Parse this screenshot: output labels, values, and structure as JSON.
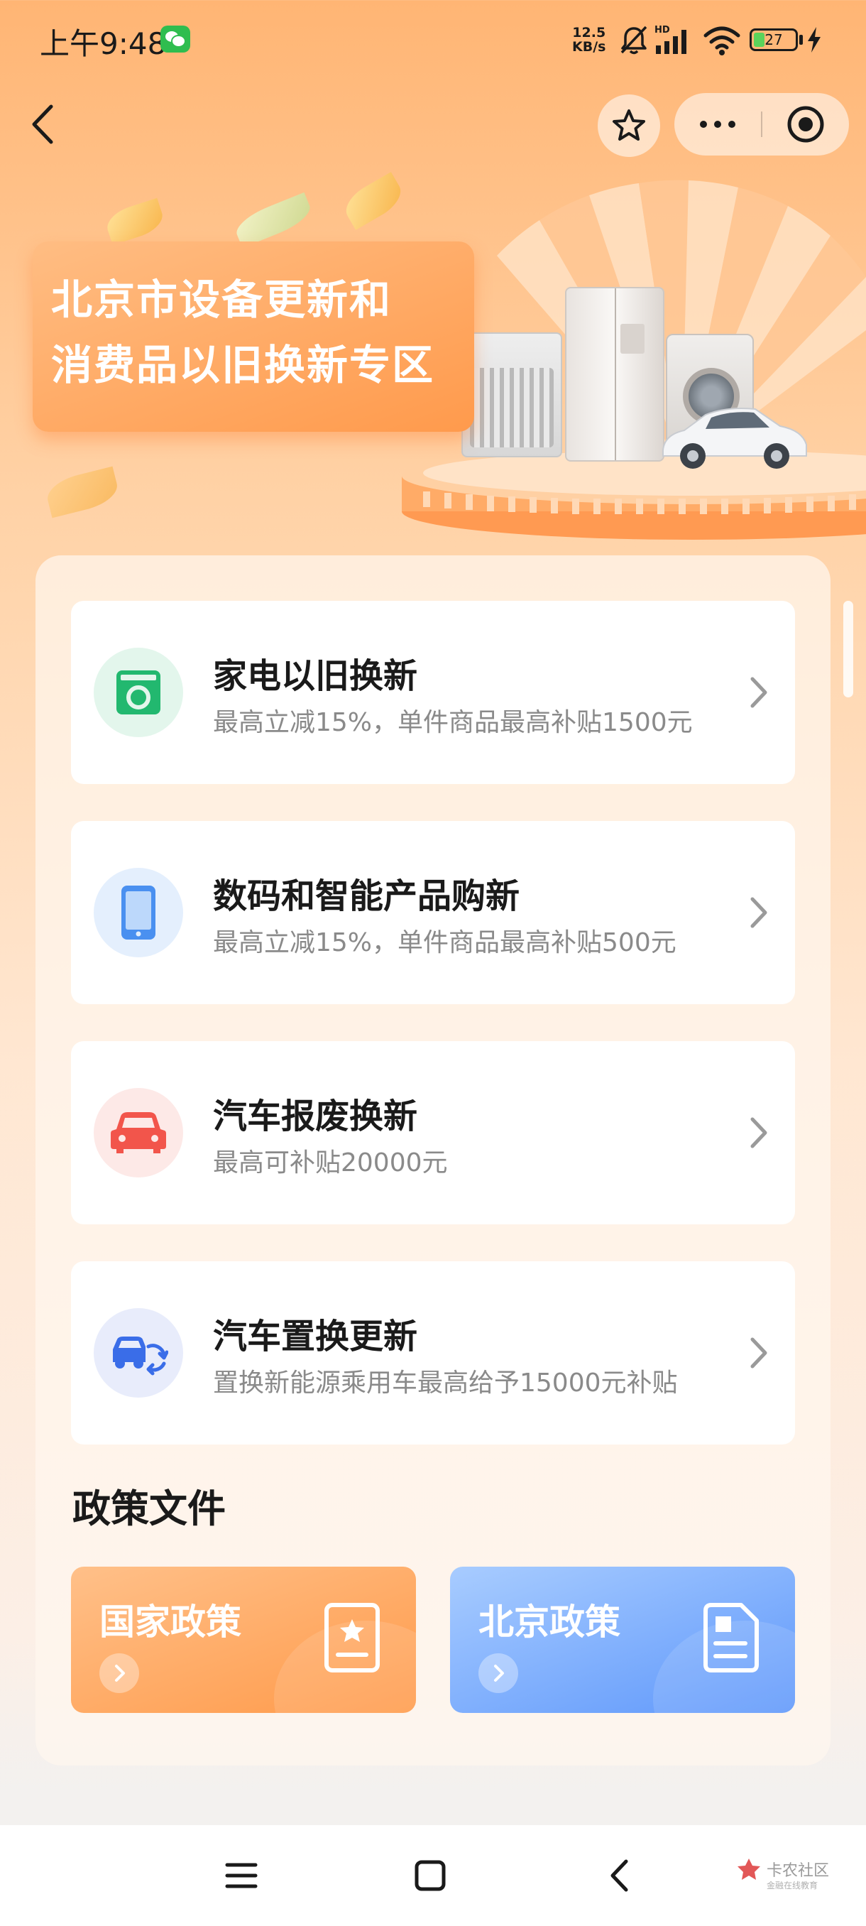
{
  "status_bar": {
    "time": "上午9:48",
    "net_speed_value": "12.5",
    "net_speed_unit": "KB/s",
    "network_type": "HD",
    "battery_level": "27",
    "icons": [
      "wechat-icon",
      "mute-bell-icon",
      "signal-icon",
      "wifi-icon",
      "battery-icon",
      "charging-icon"
    ]
  },
  "nav": {
    "icons": [
      "back-icon",
      "star-icon",
      "more-icon",
      "close-mini-program-icon"
    ]
  },
  "hero": {
    "title_line1": "北京市设备更新和",
    "title_line2": "消费品以旧换新专区"
  },
  "services": [
    {
      "title": "家电以旧换新",
      "subtitle": "最高立减15%，单件商品最高补贴1500元",
      "icon": "washing-machine-icon",
      "icon_color": "#22b86f",
      "icon_bg": "#e3f6ec"
    },
    {
      "title": "数码和智能产品购新",
      "subtitle": "最高立减15%，单件商品最高补贴500元",
      "icon": "phone-icon",
      "icon_color": "#4a90f0",
      "icon_bg": "#e4effd"
    },
    {
      "title": "汽车报废换新",
      "subtitle": "最高可补贴20000元",
      "icon": "car-icon",
      "icon_color": "#f2554b",
      "icon_bg": "#fde9e7"
    },
    {
      "title": "汽车置换更新",
      "subtitle": "置换新能源乘用车最高给予15000元补贴",
      "icon": "car-swap-icon",
      "icon_color": "#3a6de8",
      "icon_bg": "#e8ecfb"
    }
  ],
  "policy": {
    "section_title": "政策文件",
    "cards": [
      {
        "label": "国家政策",
        "icon": "document-star-icon",
        "color": "#ff9a4a"
      },
      {
        "label": "北京政策",
        "icon": "document-icon",
        "color": "#5e97fb"
      }
    ]
  },
  "system_nav": {
    "icons": [
      "menu-icon",
      "home-icon",
      "back-icon"
    ],
    "watermark_text": "卡农社区",
    "watermark_sub": "金融在线教育"
  }
}
